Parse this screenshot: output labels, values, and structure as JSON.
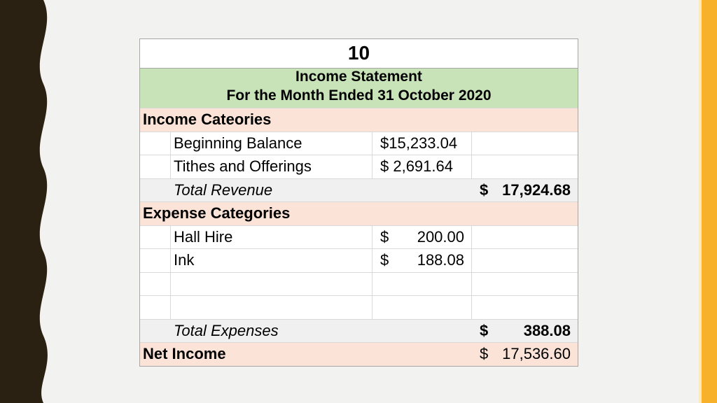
{
  "slide_number": "10",
  "statement": {
    "title": "Income Statement",
    "period": "For the Month Ended 31 October 2020"
  },
  "income": {
    "heading": "Income Cateories",
    "items": [
      {
        "label": "Beginning Balance",
        "currency": "",
        "amount": "$15,233.04"
      },
      {
        "label": "Tithes and Offerings",
        "currency": "",
        "amount": "$ 2,691.64"
      }
    ],
    "total_label": "Total Revenue",
    "total_currency": "$",
    "total_amount": "17,924.68"
  },
  "expenses": {
    "heading": "Expense Categories",
    "items": [
      {
        "label": "Hall Hire",
        "currency": "$",
        "amount": "200.00"
      },
      {
        "label": "Ink",
        "currency": "$",
        "amount": "188.08"
      }
    ],
    "total_label": "Total Expenses",
    "total_currency": "$",
    "total_amount": "388.08"
  },
  "net": {
    "label": "Net Income",
    "currency": "$",
    "amount": "17,536.60"
  },
  "colors": {
    "heading_bg": "#c9e3b8",
    "category_bg": "#fbe3d7",
    "total_bg": "#f0f0f0",
    "accent_bar": "#f8b12a",
    "left_band": "#2b2112"
  }
}
